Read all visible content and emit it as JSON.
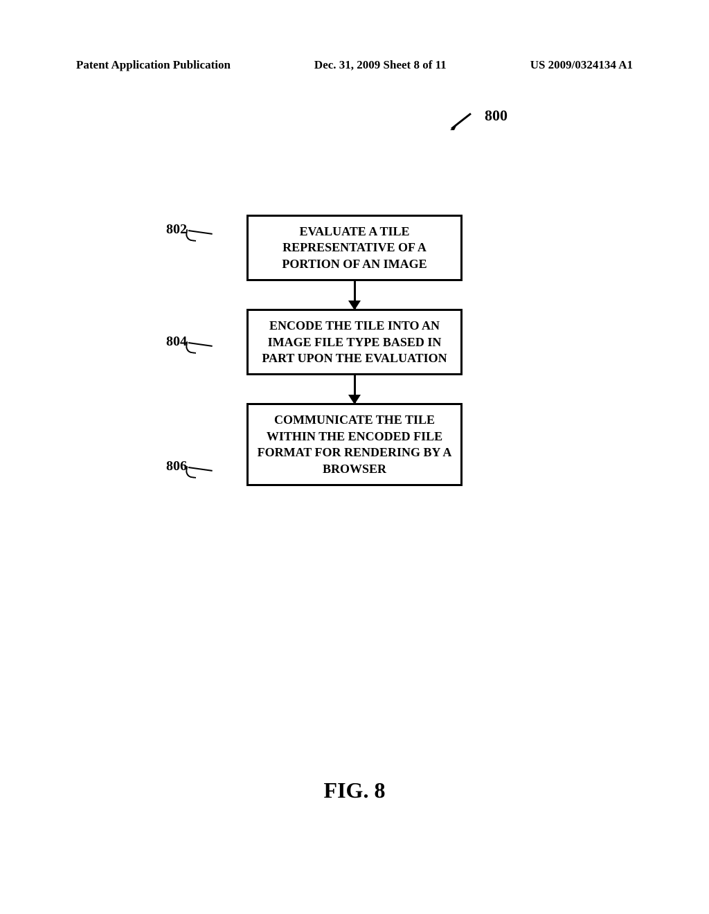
{
  "header": {
    "left": "Patent Application Publication",
    "mid": "Dec. 31, 2009  Sheet 8 of 11",
    "right": "US 2009/0324134 A1"
  },
  "figure_ref": "800",
  "steps": [
    {
      "num": "802",
      "text": "EVALUATE A TILE REPRESENTATIVE OF A PORTION OF AN IMAGE"
    },
    {
      "num": "804",
      "text": "ENCODE THE TILE INTO AN IMAGE FILE TYPE BASED IN PART UPON THE EVALUATION"
    },
    {
      "num": "806",
      "text": "COMMUNICATE THE TILE WITHIN THE ENCODED FILE FORMAT FOR RENDERING BY A BROWSER"
    }
  ],
  "caption": "FIG. 8"
}
